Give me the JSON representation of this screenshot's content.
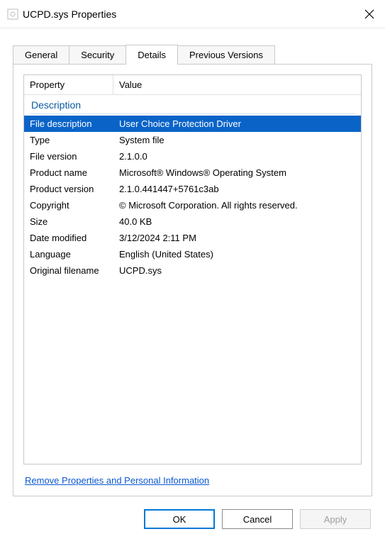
{
  "window": {
    "title": "UCPD.sys Properties"
  },
  "tabs": [
    {
      "label": "General",
      "active": false
    },
    {
      "label": "Security",
      "active": false
    },
    {
      "label": "Details",
      "active": true
    },
    {
      "label": "Previous Versions",
      "active": false
    }
  ],
  "columns": {
    "property": "Property",
    "value": "Value"
  },
  "group": "Description",
  "rows": [
    {
      "property": "File description",
      "value": "User Choice Protection Driver",
      "selected": true
    },
    {
      "property": "Type",
      "value": "System file"
    },
    {
      "property": "File version",
      "value": "2.1.0.0"
    },
    {
      "property": "Product name",
      "value": "Microsoft® Windows® Operating System"
    },
    {
      "property": "Product version",
      "value": "2.1.0.441447+5761c3ab"
    },
    {
      "property": "Copyright",
      "value": "© Microsoft Corporation. All rights reserved."
    },
    {
      "property": "Size",
      "value": "40.0 KB"
    },
    {
      "property": "Date modified",
      "value": "3/12/2024 2:11 PM"
    },
    {
      "property": "Language",
      "value": "English (United States)"
    },
    {
      "property": "Original filename",
      "value": "UCPD.sys"
    }
  ],
  "link": "Remove Properties and Personal Information",
  "buttons": {
    "ok": "OK",
    "cancel": "Cancel",
    "apply": "Apply"
  }
}
